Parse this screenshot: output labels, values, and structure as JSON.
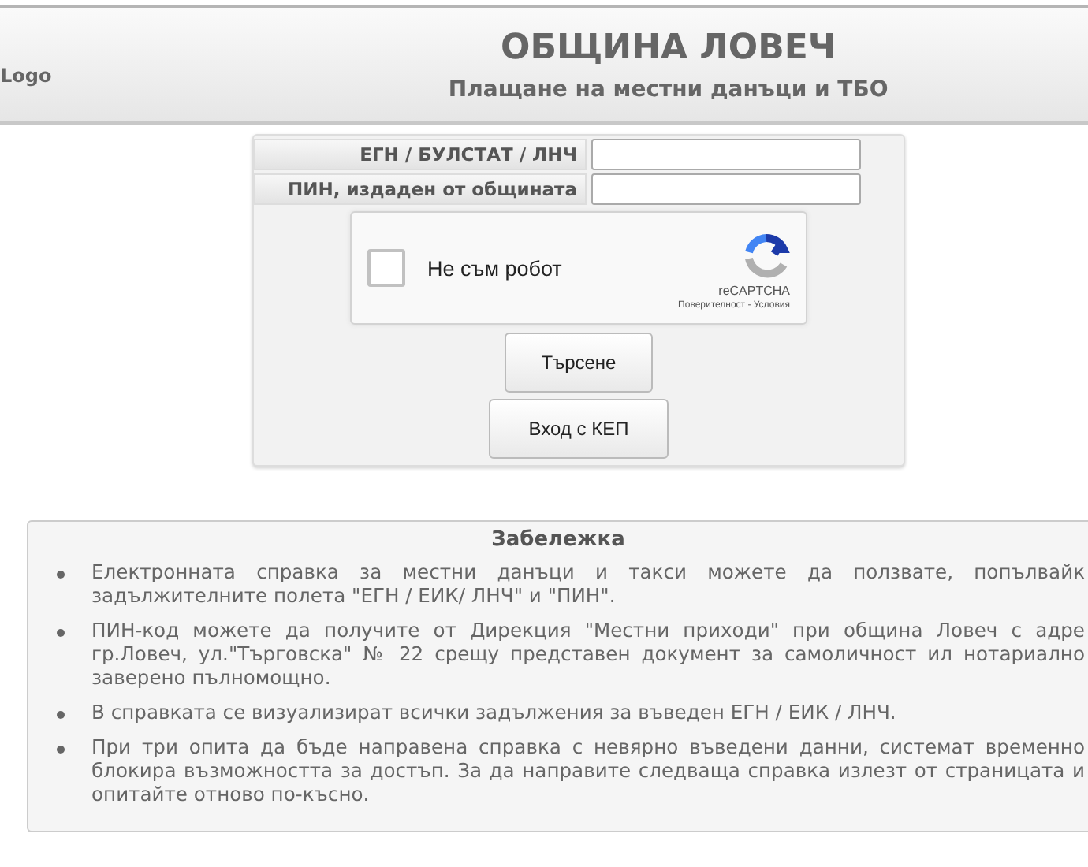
{
  "header": {
    "logo": "Logo",
    "title": "ОБЩИНА ЛОВЕЧ",
    "subtitle": "Плащане на местни данъци и ТБО"
  },
  "form": {
    "fields": [
      {
        "label": "ЕГН / БУЛСТАТ / ЛНЧ"
      },
      {
        "label": "ПИН, издаден от общината"
      }
    ],
    "captcha": {
      "label": "Не съм робот",
      "checked": false,
      "brand": "reCAPTCHA",
      "links": "Поверителност - Условия"
    },
    "buttons": [
      "Търсене",
      "Вход с КЕП"
    ]
  },
  "notes": {
    "title": "Забележка",
    "items": [
      "Електронната справка за местни данъци и такси можете да ползвате, попълвайк задължителните полета \"ЕГН / ЕИК/ ЛНЧ\" и \"ПИН\".",
      "ПИН-код можете да получите от Дирекция \"Местни приходи\" при община Ловеч с адре гр.Ловеч, ул.\"Търговска\" № 22 срещу представен документ за самоличност ил нотариално заверено пълномощно.",
      "В справката се визуализират всички задължения за въведен ЕГН / ЕИК / ЛНЧ.",
      "При три опита да бъде направена справка с невярно въведени данни, системат временно блокира възможността за достъп. За да направите следваща справка излезт от страницата и опитайте отново по-късно."
    ]
  }
}
